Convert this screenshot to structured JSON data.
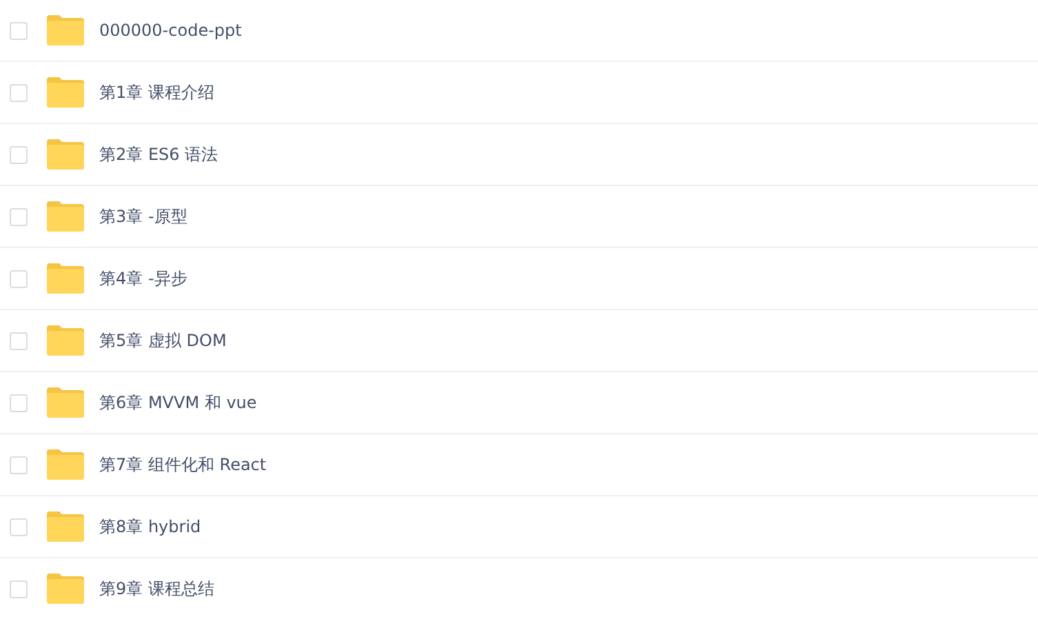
{
  "files": [
    {
      "name": "000000-code-ppt",
      "checked": false
    },
    {
      "name": "第1章 课程介绍",
      "checked": false
    },
    {
      "name": "第2章 ES6 语法",
      "checked": false
    },
    {
      "name": "第3章 -原型",
      "checked": false
    },
    {
      "name": "第4章 -异步",
      "checked": false
    },
    {
      "name": "第5章 虚拟 DOM",
      "checked": false
    },
    {
      "name": "第6章 MVVM 和 vue",
      "checked": false
    },
    {
      "name": "第7章 组件化和 React",
      "checked": false
    },
    {
      "name": "第8章 hybrid",
      "checked": false
    },
    {
      "name": "第9章 课程总结",
      "checked": false
    }
  ]
}
